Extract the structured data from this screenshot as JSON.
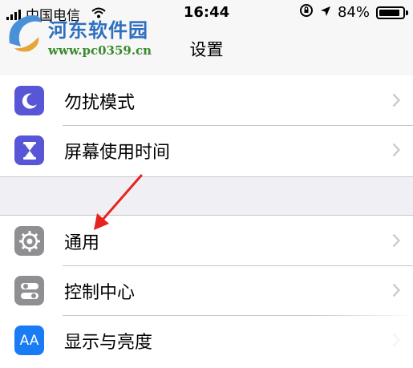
{
  "status_bar": {
    "carrier": "中国电信",
    "time": "16:44",
    "battery": "84%",
    "icons": [
      "signal-icon",
      "wifi-icon",
      "rotation-lock-icon",
      "location-icon",
      "battery-icon"
    ]
  },
  "watermark": {
    "name": "河东软件园",
    "url": "www.pc0359.cn"
  },
  "nav": {
    "title": "设置"
  },
  "settings": {
    "group1": [
      {
        "label": "勿扰模式",
        "icon": "moon-icon",
        "color": "#5856d6"
      },
      {
        "label": "屏幕使用时间",
        "icon": "hourglass-icon",
        "color": "#5856d6"
      }
    ],
    "group2": [
      {
        "label": "通用",
        "icon": "gear-icon",
        "color": "#8e8e93"
      },
      {
        "label": "控制中心",
        "icon": "toggles-icon",
        "color": "#8e8e93"
      },
      {
        "label": "显示与亮度",
        "icon": "text-size-icon",
        "icon_text": "AA",
        "color": "#1a7cf5"
      }
    ]
  },
  "annotation": {
    "type": "red-arrow",
    "color": "#e8231f",
    "points_to": "通用"
  }
}
